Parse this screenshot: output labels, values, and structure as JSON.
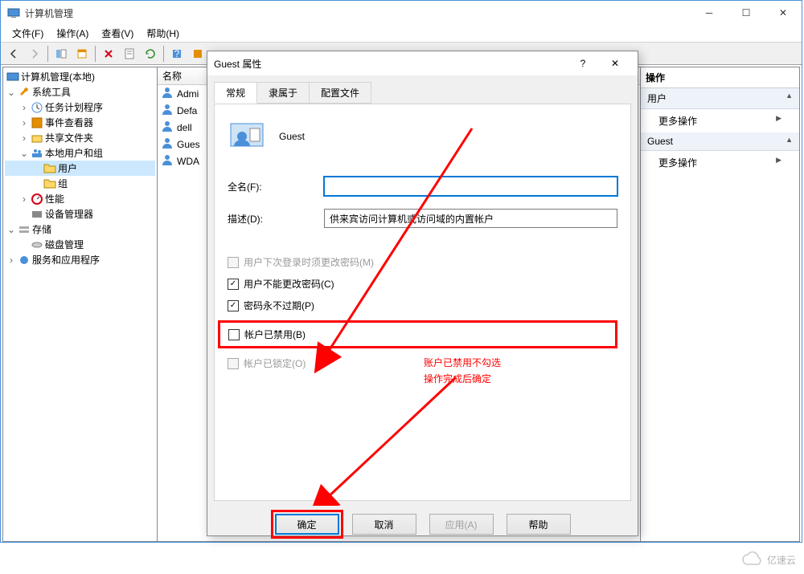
{
  "main_window": {
    "title": "计算机管理",
    "menus": [
      "文件(F)",
      "操作(A)",
      "查看(V)",
      "帮助(H)"
    ]
  },
  "tree": {
    "root": "计算机管理(本地)",
    "system_tools": "系统工具",
    "task_scheduler": "任务计划程序",
    "event_viewer": "事件查看器",
    "shared_folders": "共享文件夹",
    "local_users_groups": "本地用户和组",
    "users": "用户",
    "groups": "组",
    "performance": "性能",
    "device_manager": "设备管理器",
    "storage": "存储",
    "disk_management": "磁盘管理",
    "services_apps": "服务和应用程序"
  },
  "list": {
    "header_name": "名称",
    "rows": [
      "Admi",
      "Defa",
      "dell",
      "Gues",
      "WDA"
    ]
  },
  "actions": {
    "title": "操作",
    "group_user": "用户",
    "more": "更多操作",
    "group_guest": "Guest"
  },
  "dialog": {
    "title": "Guest 属性",
    "tabs": {
      "general": "常规",
      "member_of": "隶属于",
      "profile": "配置文件"
    },
    "username": "Guest",
    "labels": {
      "fullname": "全名(F):",
      "description": "描述(D):"
    },
    "values": {
      "fullname": "",
      "description": "供来宾访问计算机或访问域的内置帐户"
    },
    "checkboxes": {
      "must_change": "用户下次登录时须更改密码(M)",
      "cannot_change": "用户不能更改密码(C)",
      "never_expires": "密码永不过期(P)",
      "disabled": "帐户已禁用(B)",
      "locked": "帐户已锁定(O)"
    },
    "annotation_line1": "账户已禁用不勾选",
    "annotation_line2": "操作完成后确定",
    "buttons": {
      "ok": "确定",
      "cancel": "取消",
      "apply": "应用(A)",
      "help": "帮助"
    }
  },
  "watermark": "亿速云"
}
